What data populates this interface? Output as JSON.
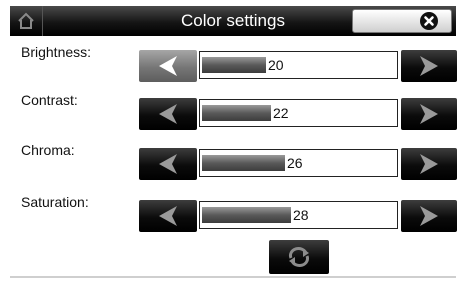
{
  "header": {
    "title": "Color settings",
    "home_icon": "home-icon",
    "close_icon": "close-circle-icon"
  },
  "settings": [
    {
      "label": "Brightness:",
      "value": "20",
      "level_percent": 33
    },
    {
      "label": "Contrast:",
      "value": "22",
      "level_percent": 36
    },
    {
      "label": "Chroma:",
      "value": "26",
      "level_percent": 43
    },
    {
      "label": "Saturation:",
      "value": "28",
      "level_percent": 46
    }
  ],
  "reset": {
    "icon": "refresh-icon"
  }
}
